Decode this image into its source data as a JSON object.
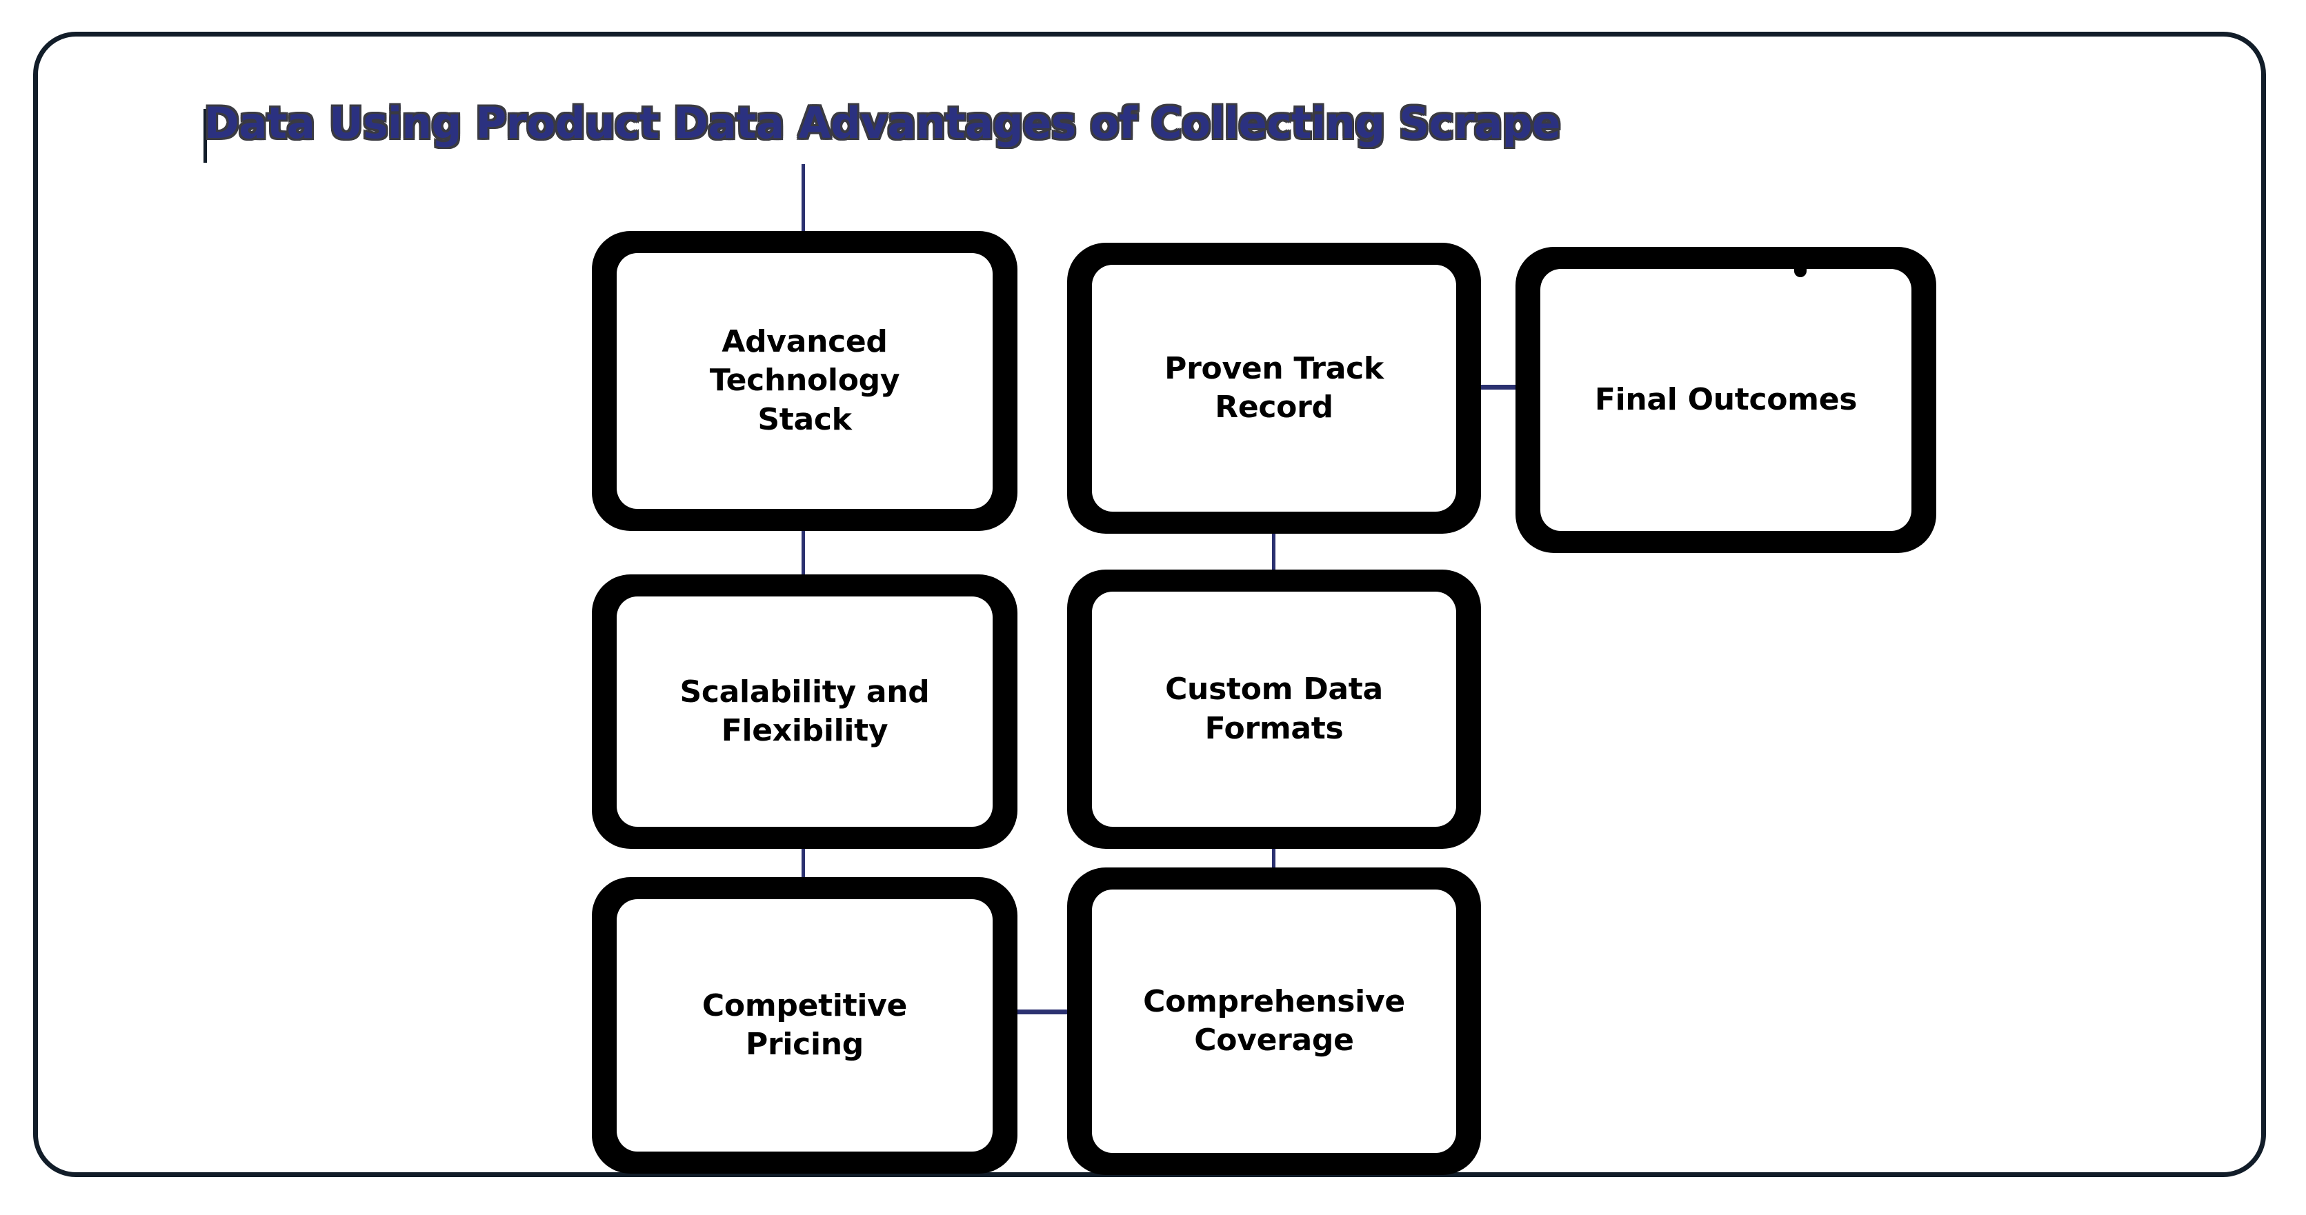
{
  "title": "Data Using Product Data Advantages of Collecting Scrape",
  "colors": {
    "frame_border": "#121d29",
    "title_text": "#2b3180",
    "title_shadow": "#3a3a42",
    "node_border": "#000000",
    "node_fill": "#ffffff",
    "node_label": "#000000",
    "connector": "#2b3170",
    "background": "#ffffff"
  },
  "diagram": {
    "nodes": [
      {
        "id": "advanced-technology-stack",
        "label": "Advanced\nTechnology\nStack",
        "column": "left",
        "row": 1
      },
      {
        "id": "scalability-flexibility",
        "label": "Scalability and\nFlexibility",
        "column": "left",
        "row": 2
      },
      {
        "id": "competitive-pricing",
        "label": "Competitive\nPricing",
        "column": "left",
        "row": 3
      },
      {
        "id": "proven-track-record",
        "label": "Proven Track\nRecord",
        "column": "middle",
        "row": 1
      },
      {
        "id": "custom-data-formats",
        "label": "Custom Data\nFormats",
        "column": "middle",
        "row": 2
      },
      {
        "id": "comprehensive-coverage",
        "label": "Comprehensive\nCoverage",
        "column": "middle",
        "row": 3
      },
      {
        "id": "final-outcomes",
        "label": "Final Outcomes",
        "column": "right",
        "row": 1
      }
    ],
    "edges": [
      {
        "from": "title",
        "to": "advanced-technology-stack",
        "orientation": "vertical"
      },
      {
        "from": "advanced-technology-stack",
        "to": "scalability-flexibility",
        "orientation": "vertical"
      },
      {
        "from": "scalability-flexibility",
        "to": "competitive-pricing",
        "orientation": "vertical"
      },
      {
        "from": "competitive-pricing",
        "to": "comprehensive-coverage",
        "orientation": "horizontal"
      },
      {
        "from": "comprehensive-coverage",
        "to": "custom-data-formats",
        "orientation": "vertical"
      },
      {
        "from": "custom-data-formats",
        "to": "proven-track-record",
        "orientation": "vertical"
      },
      {
        "from": "proven-track-record",
        "to": "final-outcomes",
        "orientation": "horizontal"
      }
    ]
  }
}
